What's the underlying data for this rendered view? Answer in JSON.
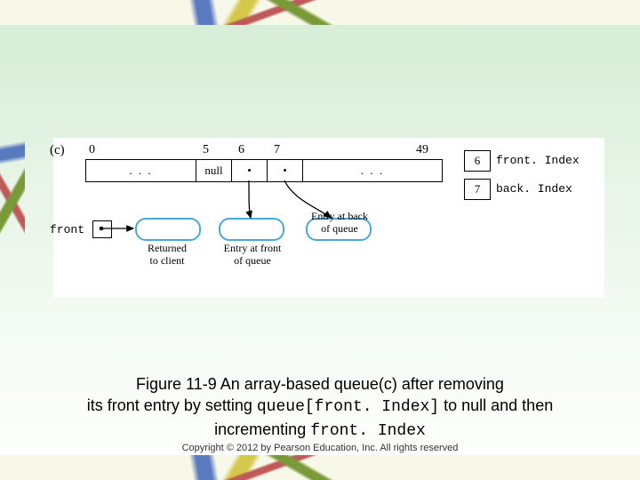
{
  "domain": "Diagram",
  "figure": {
    "part": "(c)",
    "indices": [
      "0",
      "5",
      "6",
      "7",
      "49"
    ],
    "cells": {
      "left_dots": ". . .",
      "null": "null",
      "right_dots": ". . ."
    },
    "front_label": "front",
    "ovals": {
      "returned": "Returned\nto client",
      "front_entry": "Entry at front\nof queue",
      "back_entry": "Entry at back\nof queue"
    },
    "sideboxes": {
      "frontIndex": {
        "value": "6",
        "label": "front. Index"
      },
      "backIndex": {
        "value": "7",
        "label": "back. Index"
      }
    }
  },
  "caption": {
    "line1a": "Figure 11-9 An array-based queue(c) after removing",
    "line2a": "its front entry by setting ",
    "line2code": "queue[front. Index]",
    "line2b": " to null and then",
    "line3a": "incrementing ",
    "line3code": "front. Index"
  },
  "copyright": "Copyright © 2012 by Pearson Education, Inc. All rights reserved",
  "chart_data": {
    "type": "table",
    "description": "Array-based circular queue after dequeue: queue[5] set to null, frontIndex incremented to 6, backIndex is 7, array length 50 (indices 0..49).",
    "array_length": 50,
    "shown_indices": [
      0,
      5,
      6,
      7,
      49
    ],
    "cell_state": {
      "5": "null",
      "6": "front entry",
      "7": "back entry"
    },
    "frontIndex": 6,
    "backIndex": 7,
    "front_reference_points_to": "returned-to-client oval (the removed entry)"
  }
}
